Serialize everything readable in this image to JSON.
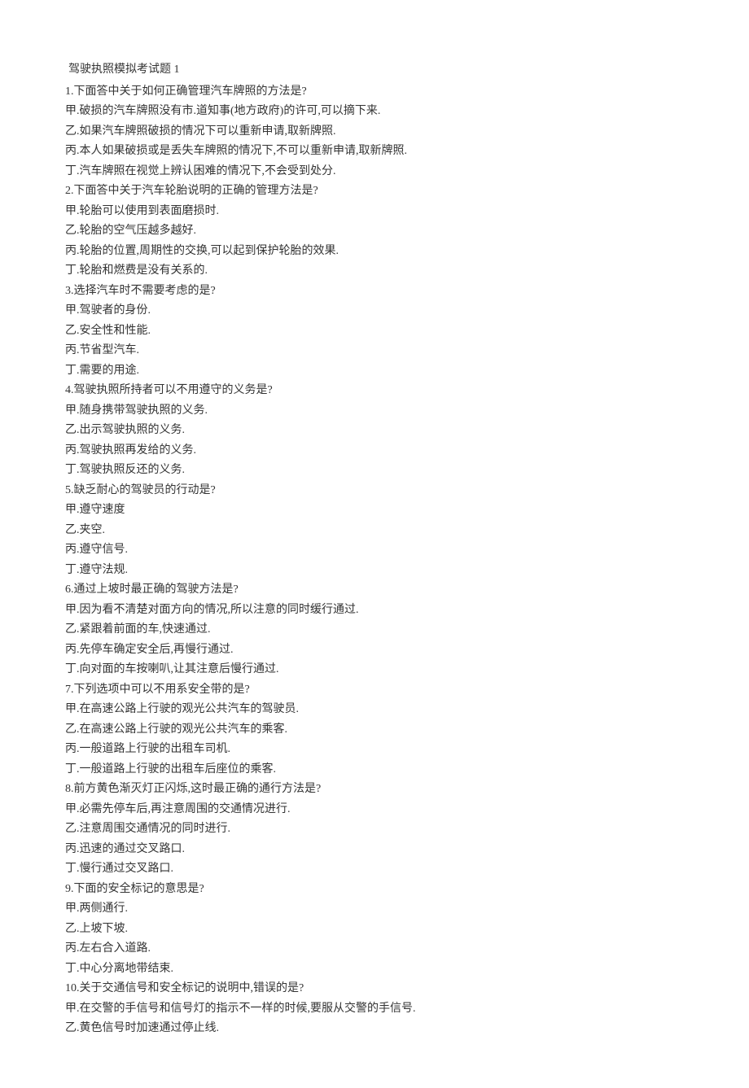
{
  "title": "驾驶执照模拟考试题  1",
  "lines": [
    "1.下面答中关于如何正确管理汽车牌照的方法是?",
    "甲.破损的汽车牌照没有市.道知事(地方政府)的许可,可以摘下来.",
    "乙.如果汽车牌照破损的情况下可以重新申请,取新牌照.",
    "丙.本人如果破损或是丢失车牌照的情况下,不可以重新申请,取新牌照.",
    "丁.汽车牌照在视觉上辨认困难的情况下,不会受到处分.",
    "2.下面答中关于汽车轮胎说明的正确的管理方法是?",
    "甲.轮胎可以使用到表面磨损时.",
    "乙.轮胎的空气压越多越好.",
    "丙.轮胎的位置,周期性的交换,可以起到保护轮胎的效果.",
    "丁.轮胎和燃费是没有关系的.",
    "3.选择汽车时不需要考虑的是?",
    "甲.驾驶者的身份.",
    "乙.安全性和性能.",
    "丙.节省型汽车.",
    "丁.需要的用途.",
    "4.驾驶执照所持者可以不用遵守的义务是?",
    "甲.随身携带驾驶执照的义务.",
    "乙.出示驾驶执照的义务.",
    "丙.驾驶执照再发给的义务.",
    "丁.驾驶执照反还的义务.",
    "5.缺乏耐心的驾驶员的行动是?",
    "甲.遵守速度",
    "乙.夹空.",
    "丙.遵守信号.",
    "丁.遵守法规.",
    "6.通过上坡时最正确的驾驶方法是?",
    "甲.因为看不清楚对面方向的情况,所以注意的同时缓行通过.",
    "乙.紧跟着前面的车,快速通过.",
    "丙.先停车确定安全后,再慢行通过.",
    "丁.向对面的车按喇叭,让其注意后慢行通过.",
    "7.下列选项中可以不用系安全带的是?",
    "甲.在高速公路上行驶的观光公共汽车的驾驶员.",
    "乙.在高速公路上行驶的观光公共汽车的乘客.",
    "丙.一般道路上行驶的出租车司机.",
    "丁.一般道路上行驶的出租车后座位的乘客.",
    "8.前方黄色渐灭灯正闪烁,这时最正确的通行方法是?",
    "甲.必需先停车后,再注意周围的交通情况进行.",
    "乙.注意周围交通情况的同时进行.",
    "丙.迅速的通过交叉路口.",
    "丁.慢行通过交叉路口.",
    "9.下面的安全标记的意思是?",
    "甲.两侧通行.",
    "乙.上坡下坡.",
    "丙.左右合入道路.",
    "丁.中心分离地带结束.",
    "10.关于交通信号和安全标记的说明中,错误的是?",
    "甲.在交警的手信号和信号灯的指示不一样的时候,要服从交警的手信号.",
    "乙.黄色信号时加速通过停止线."
  ]
}
